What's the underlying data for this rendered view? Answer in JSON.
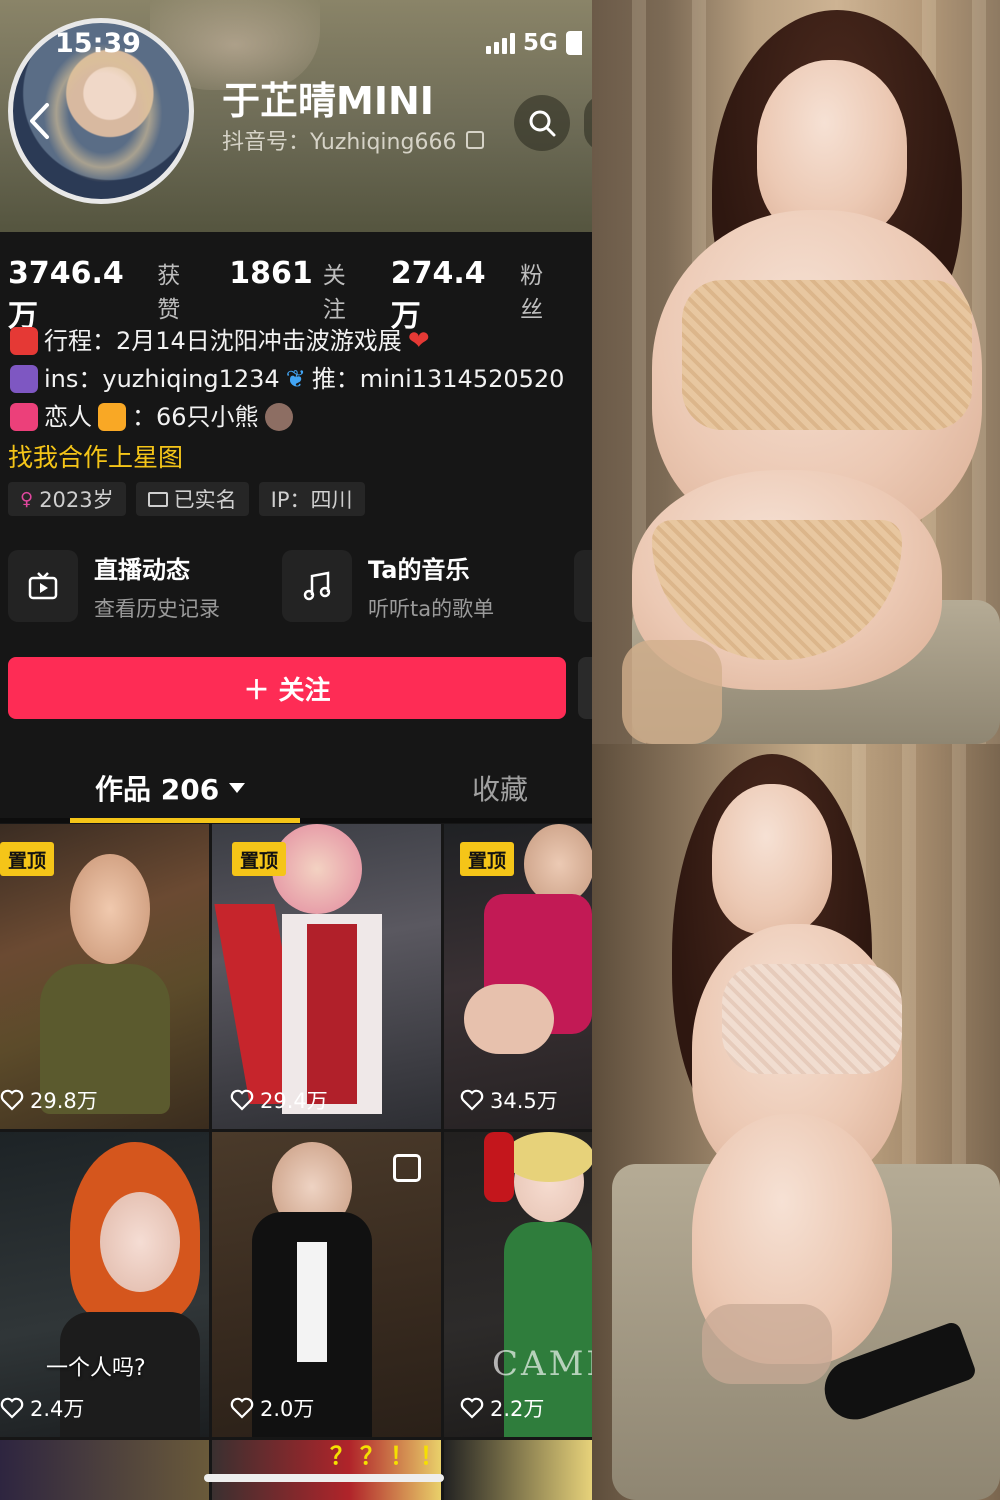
{
  "status_bar": {
    "time": "15:39",
    "network": "5G"
  },
  "profile": {
    "name": "于芷晴MINI",
    "handle": "抖音号：Yuzhiqing666",
    "stats": [
      {
        "value": "3746.4万",
        "label": "获赞"
      },
      {
        "value": "1861",
        "label": "关注"
      },
      {
        "value": "274.4万",
        "label": "粉丝"
      }
    ],
    "bio": {
      "line1": "行程：2月14日沈阳冲击波游戏展",
      "line2_a": "ins：yuzhiqing1234",
      "line2_b": "推：mini1314520520",
      "line3_a": "恋人",
      "line3_b": "：66只小熊"
    },
    "collab_link": "找我合作上星图",
    "tags": {
      "age": "2023岁",
      "verified": "已实名",
      "ip": "IP：四川"
    }
  },
  "features": [
    {
      "title": "直播动态",
      "subtitle": "查看历史记录",
      "icon": "tv-icon"
    },
    {
      "title": "Ta的音乐",
      "subtitle": "听听ta的歌单",
      "icon": "music-note-icon"
    }
  ],
  "follow_button": "＋ 关注",
  "tabs": {
    "works": "作品 206",
    "favorites": "收藏"
  },
  "videos": [
    {
      "pinned": "置顶",
      "likes": "29.8万"
    },
    {
      "pinned": "置顶",
      "likes": "29.4万"
    },
    {
      "pinned": "置顶",
      "likes": "34.5万"
    },
    {
      "likes": "2.4万",
      "caption": "一个人吗?"
    },
    {
      "likes": "2.0万"
    },
    {
      "likes": "2.2万",
      "caption": "CAMM"
    }
  ],
  "partial_row_text": "？？！！",
  "colors": {
    "accent": "#fe2c55",
    "pin": "#f5c518",
    "background": "#161616"
  }
}
